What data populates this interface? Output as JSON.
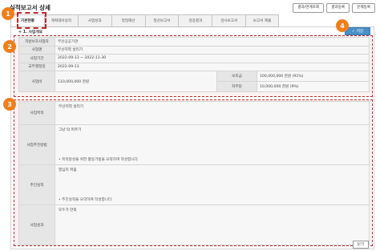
{
  "page": {
    "title": "실적보고서 상세"
  },
  "top_buttons": [
    "결과/연계조회",
    "결과등록",
    "문제등록"
  ],
  "tabs": [
    {
      "label": "기본현황",
      "active": true
    },
    {
      "label": "계획대비실적",
      "active": false
    },
    {
      "label": "사업성과",
      "active": false
    },
    {
      "label": "정밀해산",
      "active": false
    },
    {
      "label": "정산보고서",
      "active": false
    },
    {
      "label": "검증결과",
      "active": false
    },
    {
      "label": "검사보고서",
      "active": false
    },
    {
      "label": "보고서 제출",
      "active": false
    }
  ],
  "section": {
    "title": "+ 1. 사업개요",
    "save_label": "저장",
    "save_icon": "check-icon"
  },
  "overview": {
    "rows": [
      {
        "label": "지방보조사업자",
        "value": "부산공공기관"
      },
      {
        "label": "사업명",
        "value": "부산지역 살리기"
      },
      {
        "label": "사업기간",
        "value": "2022-09-13 ~ 2022-11-30"
      },
      {
        "label": "교부결정일",
        "value": "2022-09-13"
      }
    ],
    "budget": {
      "label": "사업비",
      "value": "110,000,000 천원",
      "subsidy_label": "보조금",
      "subsidy_value": "100,000,000 천원 (91%)",
      "self_label": "자부담",
      "self_value": "10,000,000 천원 (9%)"
    }
  },
  "details": [
    {
      "label": "사업목적",
      "content": "부산지역 살리기",
      "hint": ""
    },
    {
      "label": "사업추진방법",
      "content": "그냥 막 퍼주기",
      "hint": "목적달성을 위한 활동기법을 요약하여 작성합니다."
    },
    {
      "label": "추진실적",
      "content": "열심히 퍼줌",
      "hint": "추진실적을 요약하여 작성합니다."
    },
    {
      "label": "사업성과",
      "content": "모두가 만족",
      "hint": ""
    }
  ],
  "markers": [
    "1",
    "2",
    "3",
    "4"
  ],
  "close_label": "닫기",
  "colors": {
    "accent": "#ef7f1a",
    "highlight": "#c1272d",
    "primary_button": "#4a90c8"
  }
}
